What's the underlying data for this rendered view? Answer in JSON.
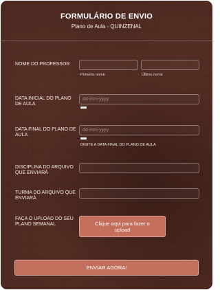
{
  "form": {
    "title": "FORMULÁRIO DE ENVIO",
    "subtitle": "Plano de Aula - QUINZENAL"
  },
  "fields": {
    "teacher_name": {
      "label": "NOME DO PROFESSOR",
      "first_name_sublabel": "Primeiro nome",
      "last_name_sublabel": "Último nome",
      "first_name_value": "",
      "last_name_value": ""
    },
    "start_date": {
      "label": "DATA INICIAL DO PLANO DE AULA",
      "placeholder": "dd-mm-yyyy",
      "value": ""
    },
    "end_date": {
      "label": "DATA FINAL DO PLANO DE AULA",
      "placeholder": "dd-mm-yyyy",
      "value": "",
      "hint": "DIGITE A DATA FINAL DO PLANO DE AULA"
    },
    "subject": {
      "label": "DISCIPLINA DO ARQUIVO QUE ENVIARÁ",
      "value": ""
    },
    "class_group": {
      "label": "TURMA DO ARQUIVO QUE ENVIARÁ",
      "value": ""
    },
    "upload": {
      "label": "FAÇA O UPLOAD DO SEU PLANO SEMANAL",
      "button_label": "Clique aqui para fazer o upload"
    }
  },
  "submit": {
    "label": "ENVIAR AGORA!"
  },
  "colors": {
    "background": "#4a2820",
    "button": "#c46e5c",
    "text": "#f3e7e2"
  }
}
